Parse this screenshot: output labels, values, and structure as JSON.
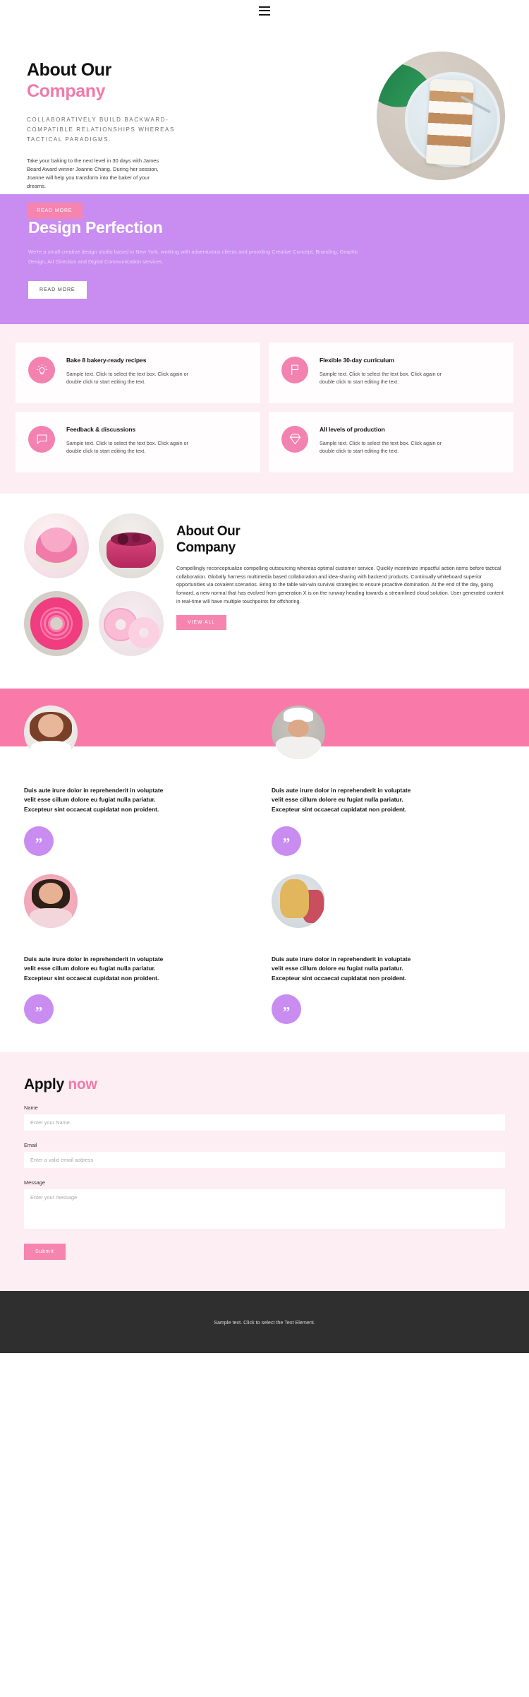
{
  "header": {
    "menu_icon": "hamburger-menu-icon"
  },
  "hero": {
    "title_line1": "About Our",
    "title_line2": "Company",
    "eyebrow": "COLLABORATIVELY BUILD BACKWARD-COMPATIBLE RELATIONSHIPS WHEREAS TACTICAL PARADIGMS.",
    "paragraph": "Take your baking to the next level in 30 days with James Beard Award winner Joanne Chang. During her session, Joanne will help you transform into the baker of your dreams.",
    "cta_label": "READ MORE",
    "image_name": "cake-slice-on-plate-photo"
  },
  "purple_section": {
    "title": "Design Perfection",
    "paragraph": "We're a small creative design studio based in New York, working with adventurous clients and providing Creative Concept, Branding, Graphic Design, Art Direction and Digital Communication services.",
    "cta_label": "READ MORE",
    "background_color": "#c98cf1"
  },
  "features": {
    "background_color": "#fdeef4",
    "body_text": "Sample text. Click to select the text box. Click again or double click to start editing the text.",
    "items": [
      {
        "icon": "lightbulb-icon",
        "title": "Bake 8 bakery-ready recipes",
        "text": "Sample text. Click to select the text box. Click again or double click to start editing the text."
      },
      {
        "icon": "flag-icon",
        "title": "Flexible 30-day curriculum",
        "text": "Sample text. Click to select the text box. Click again or double click to start editing the text."
      },
      {
        "icon": "chat-bubble-icon",
        "title": "Feedback & discussions",
        "text": "Sample text. Click to select the text box. Click again or double click to start editing the text."
      },
      {
        "icon": "diamond-icon",
        "title": "All levels of production",
        "text": "Sample text. Click to select the text box. Click again or double click to start editing the text."
      }
    ]
  },
  "about": {
    "title_line1": "About Our",
    "title_line2": "Company",
    "paragraph": "Compellingly reconceptualize compelling outsourcing whereas optimal customer service. Quickly incentivize impactful action items before tactical collaboration. Globally harness multimedia based collaboration and idea-sharing with backend products. Continually whiteboard superior opportunities via covalent scenarios. Bring to the table win-win survival strategies to ensure proactive domination. At the end of the day, going forward, a new normal that has evolved from generation X is on the runway heading towards a streamlined cloud solution. User generated content in real-time will have multiple touchpoints for offshoring.",
    "cta_label": "VIEW ALL",
    "gallery": [
      "pink-cupcakes-photo",
      "berry-cakes-photo",
      "pink-donut-photo",
      "glazed-donuts-photo"
    ]
  },
  "testimonials": {
    "band_color": "#f97aa9",
    "quote_badge_color": "#c98cf1",
    "quote_glyph": "”",
    "items": [
      {
        "avatar": "woman-in-white-shirt-photo",
        "quote": "Duis aute irure dolor in reprehenderit in voluptate velit esse cillum dolore eu fugiat nulla pariatur. Excepteur sint occaecat cupidatat non proident."
      },
      {
        "avatar": "chef-portrait-photo",
        "quote": "Duis aute irure dolor in reprehenderit in voluptate velit esse cillum dolore eu fugiat nulla pariatur. Excepteur sint occaecat cupidatat non proident."
      },
      {
        "avatar": "woman-in-pink-photo",
        "quote": "Duis aute irure dolor in reprehenderit in voluptate velit esse cillum dolore eu fugiat nulla pariatur. Excepteur sint occaecat cupidatat non proident."
      },
      {
        "avatar": "blonde-woman-photo",
        "quote": "Duis aute irure dolor in reprehenderit in voluptate velit esse cillum dolore eu fugiat nulla pariatur. Excepteur sint occaecat cupidatat non proident."
      }
    ]
  },
  "apply": {
    "title_main": "Apply",
    "title_accent": "now",
    "fields": {
      "name_label": "Name",
      "name_placeholder": "Enter your Name",
      "name_value": "",
      "email_label": "Email",
      "email_placeholder": "Enter a valid email address",
      "email_value": "",
      "message_label": "Message",
      "message_placeholder": "Enter your message",
      "message_value": ""
    },
    "submit_label": "Submit"
  },
  "footer": {
    "text": "Sample text. Click to select the Text Element.",
    "background_color": "#302f2f"
  }
}
